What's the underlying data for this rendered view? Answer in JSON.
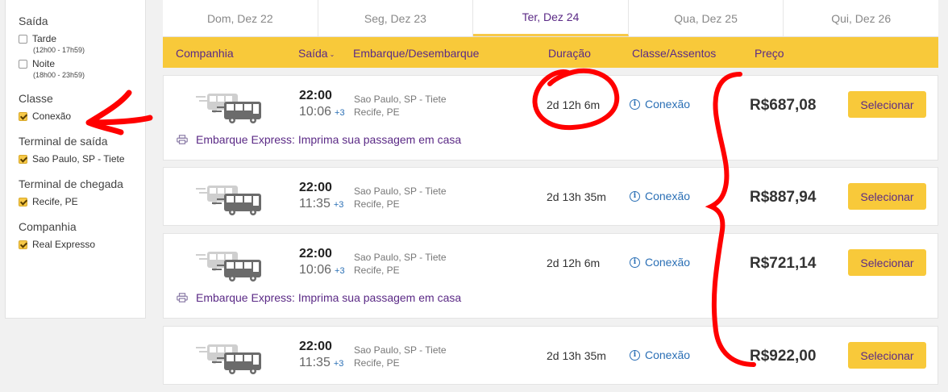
{
  "sidebar": {
    "sections": [
      {
        "heading": "Saída",
        "options": [
          {
            "label": "Tarde",
            "sub": "(12h00 - 17h59)",
            "checked": false
          },
          {
            "label": "Noite",
            "sub": "(18h00 - 23h59)",
            "checked": false
          }
        ]
      },
      {
        "heading": "Classe",
        "options": [
          {
            "label": "Conexão",
            "checked": true
          }
        ]
      },
      {
        "heading": "Terminal de saída",
        "options": [
          {
            "label": "Sao Paulo, SP - Tiete",
            "checked": true
          }
        ]
      },
      {
        "heading": "Terminal de chegada",
        "options": [
          {
            "label": "Recife, PE",
            "checked": true
          }
        ]
      },
      {
        "heading": "Companhia",
        "options": [
          {
            "label": "Real Expresso",
            "checked": true
          }
        ]
      }
    ]
  },
  "date_tabs": [
    {
      "label": "Dom, Dez 22",
      "active": false
    },
    {
      "label": "Seg, Dez 23",
      "active": false
    },
    {
      "label": "Ter, Dez 24",
      "active": true
    },
    {
      "label": "Qua, Dez 25",
      "active": false
    },
    {
      "label": "Qui, Dez 26",
      "active": false
    }
  ],
  "header": {
    "company": "Companhia",
    "departure": "Saída",
    "boarding": "Embarque/Desembarque",
    "duration": "Duração",
    "class_seats": "Classe/Assentos",
    "price": "Preço"
  },
  "trips": [
    {
      "dep": "22:00",
      "arr": "10:06",
      "plus": "+3",
      "from": "Sao Paulo, SP - Tiete",
      "to": "Recife, PE",
      "duration": "2d 12h 6m",
      "class": "Conexão",
      "price": "R$687,08",
      "button": "Selecionar",
      "express": "Embarque Express: Imprima sua passagem em casa"
    },
    {
      "dep": "22:00",
      "arr": "11:35",
      "plus": "+3",
      "from": "Sao Paulo, SP - Tiete",
      "to": "Recife, PE",
      "duration": "2d 13h 35m",
      "class": "Conexão",
      "price": "R$887,94",
      "button": "Selecionar",
      "express": null
    },
    {
      "dep": "22:00",
      "arr": "10:06",
      "plus": "+3",
      "from": "Sao Paulo, SP - Tiete",
      "to": "Recife, PE",
      "duration": "2d 12h 6m",
      "class": "Conexão",
      "price": "R$721,14",
      "button": "Selecionar",
      "express": "Embarque Express: Imprima sua passagem em casa"
    },
    {
      "dep": "22:00",
      "arr": "11:35",
      "plus": "+3",
      "from": "Sao Paulo, SP - Tiete",
      "to": "Recife, PE",
      "duration": "2d 13h 35m",
      "class": "Conexão",
      "price": "R$922,00",
      "button": "Selecionar",
      "express": null
    }
  ],
  "colors": {
    "accent": "#f8c93a",
    "brand": "#5b2a86",
    "link": "#2a6fb5",
    "annotation": "#ff0000"
  },
  "icons": [
    "bus-icon",
    "info-icon",
    "printer-icon",
    "checkbox-icon",
    "caret-down-icon"
  ]
}
